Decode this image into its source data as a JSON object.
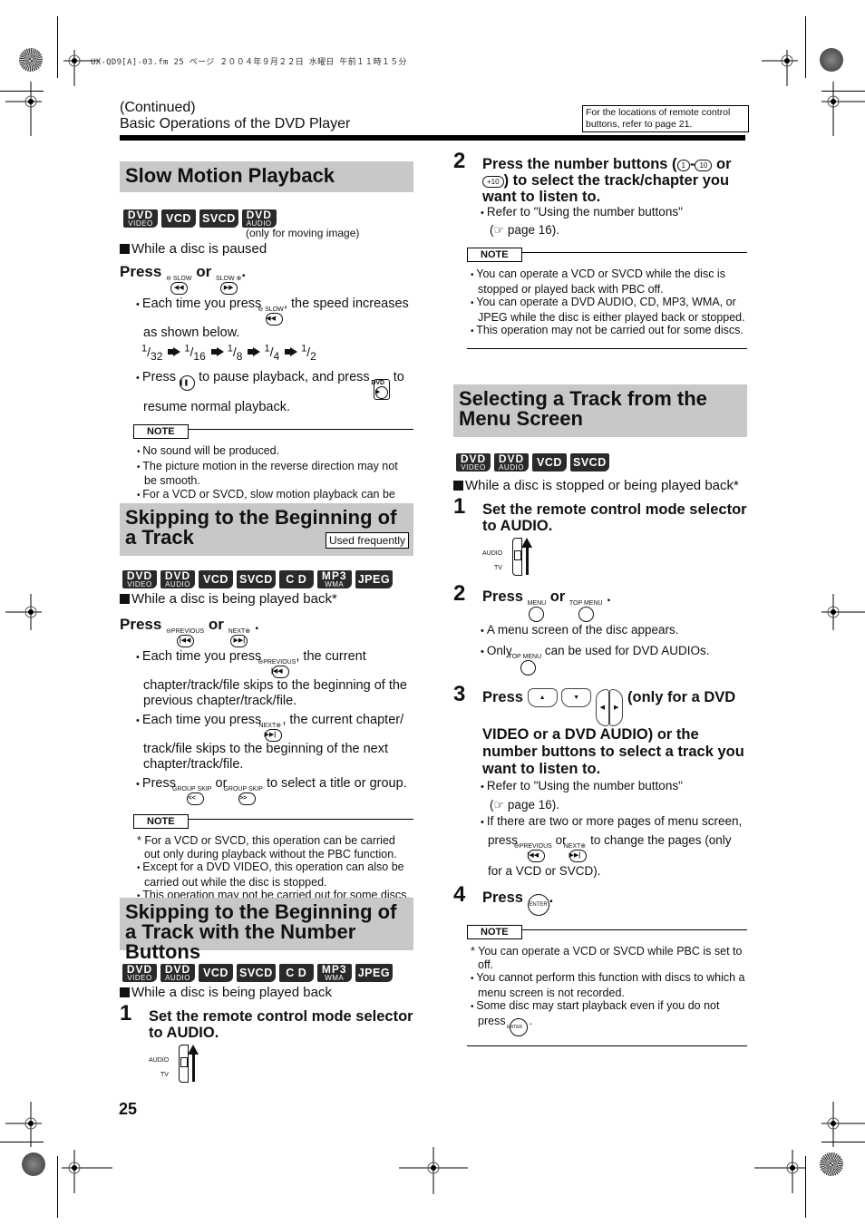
{
  "print_info": "UX-QD9[A]-03.fm  25 ページ  ２００４年９月２２日  水曜日  午前１１時１５分",
  "header": {
    "continued": "(Continued)",
    "title": "Basic Operations of the DVD Player",
    "ref_note": "For the locations of remote control buttons, refer to page 21."
  },
  "page_number": "25",
  "slow_motion": {
    "title": "Slow Motion Playback",
    "badges": [
      {
        "big": "DVD",
        "small": "VIDEO"
      },
      {
        "big": "VCD"
      },
      {
        "big": "SVCD"
      },
      {
        "big": "DVD",
        "small": "AUDIO"
      }
    ],
    "badge_note": "(only for moving image)",
    "condition": "While a disc is paused",
    "press": "Press",
    "or": "or",
    "btn_slow_rev_cap": "⊖ SLOW",
    "btn_slow_fwd_cap": "SLOW ⊕",
    "bullet1_pre": "Each time you press",
    "bullet1_post": ", the speed increases as shown below.",
    "speeds": [
      {
        "num": "1",
        "den": "32"
      },
      {
        "num": "1",
        "den": "16"
      },
      {
        "num": "1",
        "den": "8"
      },
      {
        "num": "1",
        "den": "4"
      },
      {
        "num": "1",
        "den": "2"
      }
    ],
    "bullet2_a": "Press",
    "bullet2_b": "to pause playback, and press",
    "bullet2_c": "to resume normal playback.",
    "dvd_cap": "DVD",
    "note_label": "NOTE",
    "notes": [
      {
        "mark": "dot",
        "text": "No sound will be produced."
      },
      {
        "mark": "dot",
        "text": "The picture motion in the reverse direction may not be smooth."
      },
      {
        "mark": "dot",
        "text": "For a VCD or SVCD, slow motion playback can be carried out in the forward direction only."
      }
    ]
  },
  "skip_track": {
    "title": "Skipping to the Beginning of a Track",
    "used_frequently": "Used frequently",
    "badges": [
      {
        "big": "DVD",
        "small": "VIDEO"
      },
      {
        "big": "DVD",
        "small": "AUDIO"
      },
      {
        "big": "VCD"
      },
      {
        "big": "SVCD"
      },
      {
        "big": "C D"
      },
      {
        "big": "MP3",
        "small": "WMA"
      },
      {
        "big": "JPEG"
      }
    ],
    "condition": "While a disc is being played back*",
    "press": "Press",
    "or": "or",
    "prev_cap": "⊖PREVIOUS",
    "next_cap": "NEXT⊕",
    "group_skip_cap": "GROUP SKIP",
    "bullet1_pre": "Each time you press",
    "bullet1_post": ", the current chapter/track/file skips to the beginning of the previous chapter/track/file.",
    "bullet2_pre": "Each time you press",
    "bullet2_post": ", the current chapter/ track/file skips to the beginning of the next chapter/track/file.",
    "bullet3_pre": "Press",
    "bullet3_mid": "or",
    "bullet3_post": "to select a title or group.",
    "note_label": "NOTE",
    "notes": [
      {
        "mark": "star",
        "text": "For a VCD or SVCD, this operation can be carried out only during playback without the PBC function."
      },
      {
        "mark": "dot",
        "text": "Except for a DVD VIDEO, this operation can also be carried out while the disc is stopped."
      },
      {
        "mark": "dot",
        "text": "This operation may not be carried out for some discs."
      }
    ]
  },
  "skip_number": {
    "title": "Skipping to the Beginning of a Track with the Number Buttons",
    "badges": [
      {
        "big": "DVD",
        "small": "VIDEO"
      },
      {
        "big": "DVD",
        "small": "AUDIO"
      },
      {
        "big": "VCD"
      },
      {
        "big": "SVCD"
      },
      {
        "big": "C D"
      },
      {
        "big": "MP3",
        "small": "WMA"
      },
      {
        "big": "JPEG"
      }
    ],
    "condition": "While a disc is being played back",
    "step1": {
      "num": "1",
      "text": "Set the remote control mode selector to AUDIO."
    },
    "selector_audio": "AUDIO",
    "selector_tv": "TV",
    "step2": {
      "num": "2",
      "text_a": "Press the number buttons (",
      "btn_1": "1",
      "dash": "-",
      "btn_10": "10",
      "text_b": "or",
      "btn_plus10": "+10",
      "text_c": ") to select the track/chapter you want to listen to."
    },
    "ref_bullet": "Refer to \"Using the number buttons\"",
    "ref_page": "page 16).",
    "note_label": "NOTE",
    "notes": [
      {
        "mark": "dot",
        "text": "You can operate a VCD or SVCD while the disc is stopped or played back with PBC off."
      },
      {
        "mark": "dot",
        "text": "You can operate a DVD AUDIO, CD, MP3, WMA, or JPEG while the disc is either played back or stopped."
      },
      {
        "mark": "dot",
        "text": "This operation may not be carried out for some discs."
      }
    ]
  },
  "menu_screen": {
    "title": "Selecting a Track from the Menu Screen",
    "badges": [
      {
        "big": "DVD",
        "small": "VIDEO"
      },
      {
        "big": "DVD",
        "small": "AUDIO"
      },
      {
        "big": "VCD"
      },
      {
        "big": "SVCD"
      }
    ],
    "condition": "While a disc is stopped or being played back*",
    "step1": {
      "num": "1",
      "text": "Set the remote control mode selector to AUDIO."
    },
    "selector_audio": "AUDIO",
    "selector_tv": "TV",
    "step2": {
      "num": "2",
      "press": "Press",
      "or": "or",
      "menu_cap": "MENU",
      "top_menu_cap": "TOP MENU"
    },
    "step2_bullet1": "A menu screen of the disc appears.",
    "step2_bullet2_pre": "Only",
    "step2_bullet2_post": "can be used for DVD AUDIOs.",
    "step3": {
      "num": "3",
      "press": "Press",
      "text": "(only for a DVD VIDEO or a DVD AUDIO) or the number buttons to select a track you want to listen to."
    },
    "step3_bullet1": "Refer to \"Using the number buttons\"",
    "step3_ref_page": "page 16).",
    "step3_bullet2_a": "If there are two or more pages of menu screen, press",
    "step3_bullet2_or": "or",
    "step3_bullet2_b": "to change the pages (only for a VCD or SVCD).",
    "prev_cap": "⊖PREVIOUS",
    "next_cap": "NEXT⊕",
    "step4": {
      "num": "4",
      "press": "Press",
      "enter": "ENTER"
    },
    "note_label": "NOTE",
    "notes": [
      {
        "mark": "star",
        "text": "You can operate a VCD or SVCD while PBC is set to off."
      },
      {
        "mark": "dot",
        "text": "You cannot perform this function with discs to which a menu screen is not recorded."
      },
      {
        "mark": "dot",
        "text": "Some disc may start playback even if you do not press"
      }
    ]
  }
}
